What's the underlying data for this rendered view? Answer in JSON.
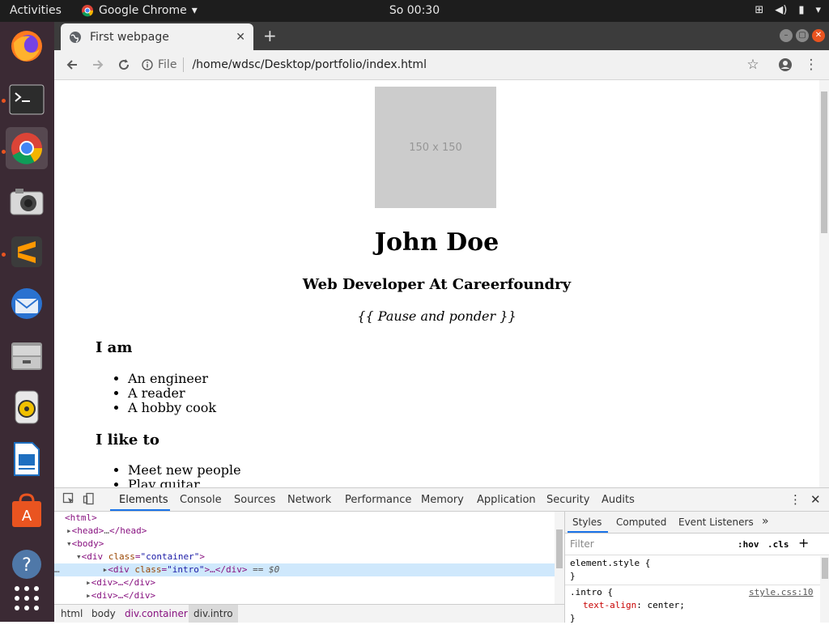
{
  "topbar": {
    "activities": "Activities",
    "app_name": "Google Chrome",
    "clock": "So 00:30"
  },
  "dock": {
    "items": [
      "firefox-icon",
      "terminal-icon",
      "chrome-icon",
      "camera-icon",
      "sublime-icon",
      "thunderbird-icon",
      "files-icon",
      "rhythmbox-icon",
      "writer-icon",
      "software-icon",
      "help-icon",
      "apps-grid-icon"
    ]
  },
  "browser": {
    "tab_title": "First webpage",
    "url_scheme": "File",
    "url": "/home/wdsc/Desktop/portfolio/index.html"
  },
  "page": {
    "image_label": "150 x 150",
    "name": "John Doe",
    "role": "Web Developer At Careerfoundry",
    "quote": "{{ Pause and ponder }}",
    "section1_title": "I am",
    "section1_items": [
      "An engineer",
      "A reader",
      "A hobby cook"
    ],
    "section2_title": "I like to",
    "section2_items": [
      "Meet new people",
      "Play guitar"
    ]
  },
  "devtools": {
    "tabs": [
      "Elements",
      "Console",
      "Sources",
      "Network",
      "Performance",
      "Memory",
      "Application",
      "Security",
      "Audits"
    ],
    "dom": {
      "html": "<html>",
      "head_open": "<head>",
      "head_ellipsis": "…",
      "head_close": "</head>",
      "body": "<body>",
      "container_tag": "<div",
      "container_attr": "class",
      "container_value": "\"container\"",
      "container_end": ">",
      "intro_tag": "<div",
      "intro_attr": "class",
      "intro_value": "\"intro\"",
      "intro_rest": ">…</div>",
      "intro_marker": "== $0",
      "div1": "<div>…</div>",
      "div2": "<div>…</div>"
    },
    "breadcrumbs": [
      "html",
      "body",
      "div.container",
      "div.intro"
    ],
    "styles_tabs": [
      "Styles",
      "Computed",
      "Event Listeners"
    ],
    "filter_placeholder": "Filter",
    "hov": ":hov",
    "cls": ".cls",
    "element_style": "element.style {",
    "close_brace": "}",
    "rule_selector": ".intro {",
    "rule_source": "style.css:10",
    "rule_property": "text-align",
    "rule_value": "center;",
    "rule_close": "}"
  },
  "colors": {
    "accent": "#1a73e8",
    "ubuntu_orange": "#e95420",
    "dock_bg": "#3b2a34"
  }
}
